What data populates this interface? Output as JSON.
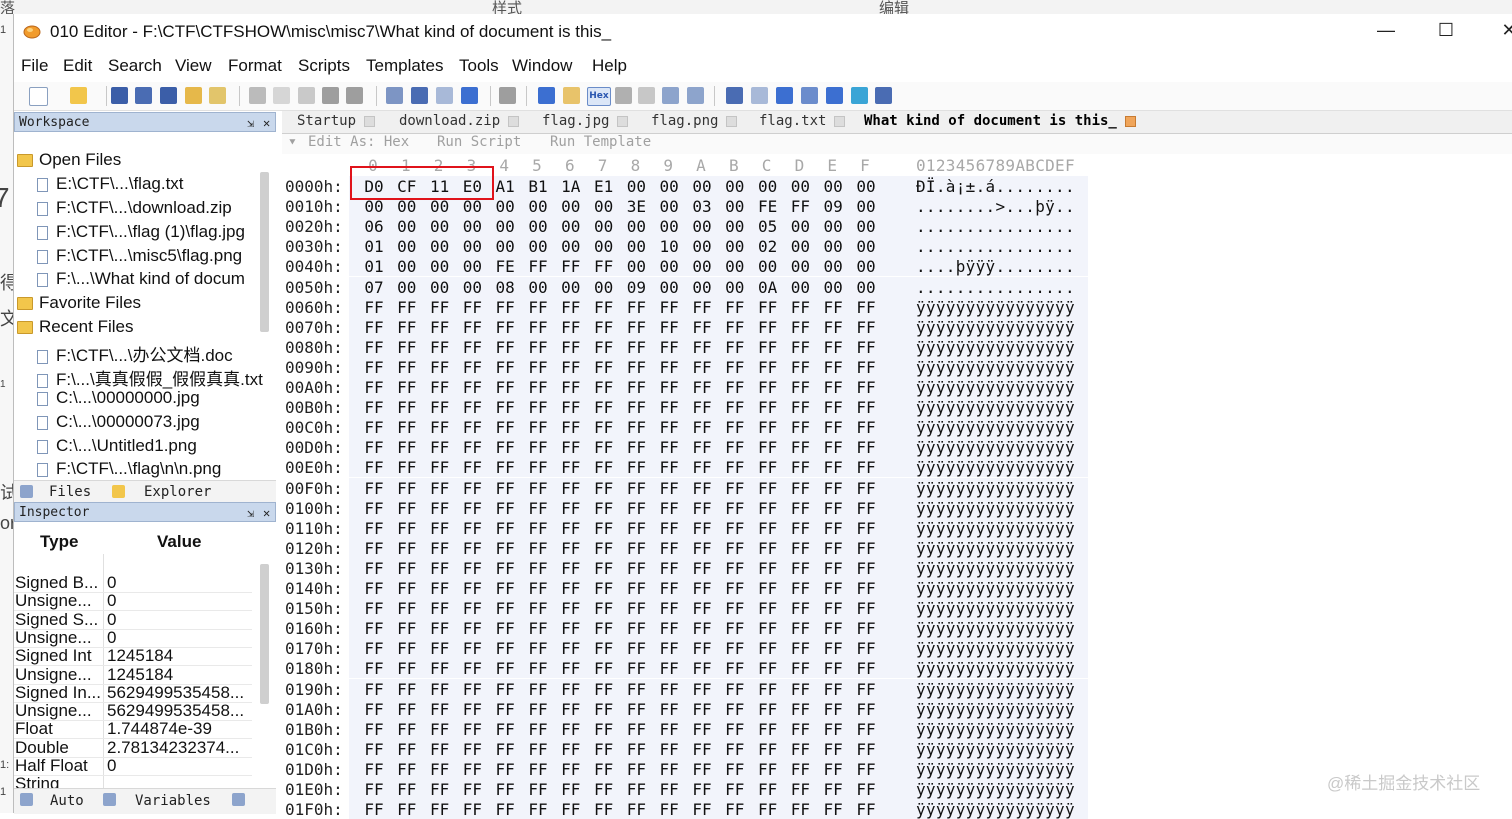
{
  "background_app": {
    "ribbon_labels": [
      "落",
      "样式",
      "编辑"
    ],
    "left_glyphs": [
      "1",
      "7",
      "得",
      "文",
      "1",
      "试",
      "or",
      "1:",
      "1"
    ]
  },
  "window": {
    "title": "010 Editor - F:\\CTF\\CTFSHOW\\misc\\misc7\\What kind of document is this_",
    "controls": {
      "minimize": "—",
      "maximize": "☐",
      "close": "✕"
    }
  },
  "menu": [
    "File",
    "Edit",
    "Search",
    "View",
    "Format",
    "Scripts",
    "Templates",
    "Tools",
    "Window",
    "Help"
  ],
  "toolbar": {
    "hex_label": "Hex"
  },
  "workspace": {
    "title": "Workspace",
    "pin": "⇲",
    "close": "✕",
    "open_files_label": "Open Files",
    "open_files": [
      "E:\\CTF\\...\\flag.txt",
      "F:\\CTF\\...\\download.zip",
      "F:\\CTF\\...\\flag (1)\\flag.jpg",
      "F:\\CTF\\...\\misc5\\flag.png",
      "F:\\...\\What kind of docum"
    ],
    "favorite_files_label": "Favorite Files",
    "recent_files_label": "Recent Files",
    "recent_files": [
      "F:\\CTF\\...\\办公文档.doc",
      "F:\\...\\真真假假_假假真真.txt",
      "C:\\...\\00000000.jpg",
      "C:\\...\\00000073.jpg",
      "C:\\...\\Untitled1.png",
      "F:\\CTF\\...\\flag\\n\\n.png"
    ],
    "tabs": {
      "files": "Files",
      "explorer": "Explorer"
    }
  },
  "inspector": {
    "title": "Inspector",
    "pin": "⇲",
    "close": "✕",
    "col_type": "Type",
    "col_value": "Value",
    "rows": [
      {
        "type": "Signed B...",
        "value": "0"
      },
      {
        "type": "Unsigne...",
        "value": "0"
      },
      {
        "type": "Signed S...",
        "value": "0"
      },
      {
        "type": "Unsigne...",
        "value": "0"
      },
      {
        "type": "Signed Int",
        "value": "1245184"
      },
      {
        "type": "Unsigne...",
        "value": "1245184"
      },
      {
        "type": "Signed In...",
        "value": "5629499535458..."
      },
      {
        "type": "Unsigne...",
        "value": "5629499535458..."
      },
      {
        "type": "Float",
        "value": "1.744874e-39"
      },
      {
        "type": "Double",
        "value": "2.78134232374..."
      },
      {
        "type": "Half Float",
        "value": "0"
      },
      {
        "type": "String",
        "value": ""
      }
    ],
    "tabs": {
      "auto": "Auto",
      "variables": "Variables"
    }
  },
  "editor": {
    "tabs": [
      "Startup",
      "download.zip",
      "flag.jpg",
      "flag.png",
      "flag.txt",
      "What kind of document is this_"
    ],
    "active_tab_index": 5,
    "subbar": {
      "edit_as": "Edit As: Hex",
      "run_script": "Run Script",
      "run_template": "Run Template"
    },
    "column_headers": [
      "0",
      "1",
      "2",
      "3",
      "4",
      "5",
      "6",
      "7",
      "8",
      "9",
      "A",
      "B",
      "C",
      "D",
      "E",
      "F"
    ],
    "ascii_header": "0123456789ABCDEF",
    "highlighted_bytes": "D0 CF 11 E0",
    "rows": [
      {
        "addr": "0000h:",
        "bytes": [
          "D0",
          "CF",
          "11",
          "E0",
          "A1",
          "B1",
          "1A",
          "E1",
          "00",
          "00",
          "00",
          "00",
          "00",
          "00",
          "00",
          "00"
        ],
        "ascii": "ÐÏ.à¡±.á........"
      },
      {
        "addr": "0010h:",
        "bytes": [
          "00",
          "00",
          "00",
          "00",
          "00",
          "00",
          "00",
          "00",
          "3E",
          "00",
          "03",
          "00",
          "FE",
          "FF",
          "09",
          "00"
        ],
        "ascii": "........>...þÿ.."
      },
      {
        "addr": "0020h:",
        "bytes": [
          "06",
          "00",
          "00",
          "00",
          "00",
          "00",
          "00",
          "00",
          "00",
          "00",
          "00",
          "00",
          "05",
          "00",
          "00",
          "00"
        ],
        "ascii": "................"
      },
      {
        "addr": "0030h:",
        "bytes": [
          "01",
          "00",
          "00",
          "00",
          "00",
          "00",
          "00",
          "00",
          "00",
          "10",
          "00",
          "00",
          "02",
          "00",
          "00",
          "00"
        ],
        "ascii": "................"
      },
      {
        "addr": "0040h:",
        "bytes": [
          "01",
          "00",
          "00",
          "00",
          "FE",
          "FF",
          "FF",
          "FF",
          "00",
          "00",
          "00",
          "00",
          "00",
          "00",
          "00",
          "00"
        ],
        "ascii": "....þÿÿÿ........"
      },
      {
        "addr": "0050h:",
        "bytes": [
          "07",
          "00",
          "00",
          "00",
          "08",
          "00",
          "00",
          "00",
          "09",
          "00",
          "00",
          "00",
          "0A",
          "00",
          "00",
          "00"
        ],
        "ascii": "................"
      },
      {
        "addr": "0060h:",
        "ff": true
      },
      {
        "addr": "0070h:",
        "ff": true
      },
      {
        "addr": "0080h:",
        "ff": true
      },
      {
        "addr": "0090h:",
        "ff": true
      },
      {
        "addr": "00A0h:",
        "ff": true
      },
      {
        "addr": "00B0h:",
        "ff": true
      },
      {
        "addr": "00C0h:",
        "ff": true
      },
      {
        "addr": "00D0h:",
        "ff": true
      },
      {
        "addr": "00E0h:",
        "ff": true
      },
      {
        "addr": "00F0h:",
        "ff": true
      },
      {
        "addr": "0100h:",
        "ff": true
      },
      {
        "addr": "0110h:",
        "ff": true
      },
      {
        "addr": "0120h:",
        "ff": true
      },
      {
        "addr": "0130h:",
        "ff": true
      },
      {
        "addr": "0140h:",
        "ff": true
      },
      {
        "addr": "0150h:",
        "ff": true
      },
      {
        "addr": "0160h:",
        "ff": true
      },
      {
        "addr": "0170h:",
        "ff": true
      },
      {
        "addr": "0180h:",
        "ff": true
      },
      {
        "addr": "0190h:",
        "ff": true
      },
      {
        "addr": "01A0h:",
        "ff": true
      },
      {
        "addr": "01B0h:",
        "ff": true
      },
      {
        "addr": "01C0h:",
        "ff": true
      },
      {
        "addr": "01D0h:",
        "ff": true
      },
      {
        "addr": "01E0h:",
        "ff": true
      },
      {
        "addr": "01F0h:",
        "ff": true
      }
    ],
    "ff_byte": "FF",
    "ff_ascii": "ÿÿÿÿÿÿÿÿÿÿÿÿÿÿÿÿ"
  },
  "watermark": "@稀土掘金技术社区",
  "colors": {
    "panel_title_bg": "#c9d8ec",
    "highlight_border": "#e0131b",
    "hex_band": "#f2f4fb"
  }
}
